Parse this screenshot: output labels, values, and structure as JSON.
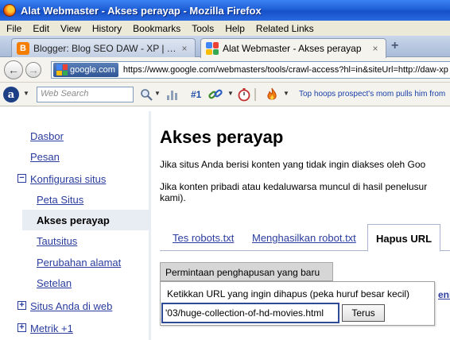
{
  "window": {
    "title": "Alat Webmaster - Akses perayap - Mozilla Firefox"
  },
  "menu": [
    "File",
    "Edit",
    "View",
    "History",
    "Bookmarks",
    "Tools",
    "Help",
    "Related Links"
  ],
  "tabs": [
    {
      "label": "Blogger: Blog SEO DAW - XP | Tutori...",
      "icon": "blogger-icon",
      "close": "×"
    },
    {
      "label": "Alat Webmaster - Akses perayap",
      "icon": "webmaster-tools-icon",
      "close": "×"
    }
  ],
  "new_tab": "+",
  "nav": {
    "site_identity": "google.com",
    "url": "https://www.google.com/webmasters/tools/crawl-access?hl=in&siteUrl=http://daw-xp"
  },
  "toolbar": {
    "search_placeholder": "Web Search",
    "rank": "#1",
    "news": "Top hoops prospect's mom pulls him from"
  },
  "sidebar": {
    "items": [
      {
        "label": "Dasbor"
      },
      {
        "label": "Pesan"
      },
      {
        "label": "Konfigurasi situs",
        "expander": "−"
      },
      {
        "label": "Peta Situs"
      },
      {
        "label": "Akses perayap"
      },
      {
        "label": "Tautsitus"
      },
      {
        "label": "Perubahan alamat"
      },
      {
        "label": "Setelan"
      },
      {
        "label": "Situs Anda di web",
        "expander": "+"
      },
      {
        "label": "Metrik +1",
        "expander": "+"
      }
    ]
  },
  "main": {
    "title": "Akses perayap",
    "desc1": "Jika situs Anda berisi konten yang tidak ingin diakses oleh Goo",
    "desc2a": "Jika konten pribadi atau kedaluwarsa muncul di hasil penelusur",
    "desc2b": "kami).",
    "tabs": [
      "Tes robots.txt",
      "Menghasilkan robot.txt",
      "Hapus URL"
    ],
    "new_request_button": "Permintaan penghapusan yang baru",
    "popup_label": "Ketikkan URL yang ingin dihapus (peka huruf besar kecil)",
    "url_value": "'03/huge-collection-of-hd-movies.html",
    "continue_button": "Terus",
    "truncated_link": "eni"
  }
}
